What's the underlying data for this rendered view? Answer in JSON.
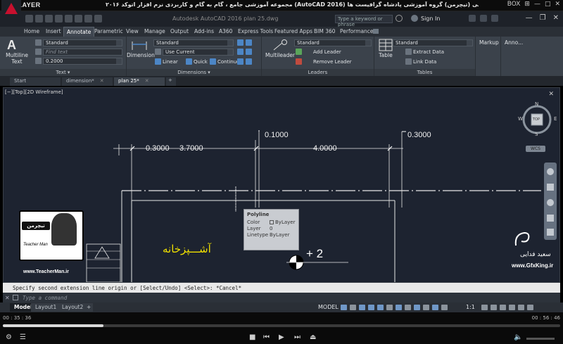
{
  "player": {
    "logo": "KMPLAYER",
    "title": "مجموعه آموزشی جامع ، گام به گام و کاربردی نرم افزار اتوکد ۲۰۱۶ (AutoCAD 2016) مدرس : سعید فدایی (تیچرمن) گروه آموزشی پادشاه گرافیست ها",
    "controls": [
      "BOX",
      "⊞",
      "—",
      "□",
      "✕"
    ],
    "time_elapsed": "00 : 35 : 36",
    "time_total": "00 : 56 : 46",
    "progress": 0.18
  },
  "acad": {
    "app_title": "Autodesk AutoCAD 2016   plan 25.dwg",
    "search_placeholder": "Type a keyword or phrase",
    "signin": "Sign In",
    "tabs": [
      "Home",
      "Insert",
      "Annotate",
      "Parametric",
      "View",
      "Manage",
      "Output",
      "Add-ins",
      "A360",
      "Express Tools",
      "Featured Apps",
      "BIM 360",
      "Performance"
    ],
    "active_tab": "Annotate"
  },
  "ribbon": {
    "text_panel": {
      "big_label_1": "Multiline",
      "big_label_2": "Text",
      "style": "Standard",
      "find_placeholder": "Find text",
      "height": "0.2000",
      "label": "Text ▾"
    },
    "dim_panel": {
      "big_label": "Dimension",
      "style": "Standard",
      "layer": "Use Current",
      "linear": "Linear",
      "quick": "Quick",
      "continue": "Continue",
      "label": "Dimensions ▾"
    },
    "leader_panel": {
      "big_label": "Multileader",
      "style": "Standard",
      "add": "Add Leader",
      "remove": "Remove Leader",
      "label": "Leaders"
    },
    "table_panel": {
      "big_label": "Table",
      "style": "Standard",
      "extract": "Extract Data",
      "link": "Link Data",
      "label": "Tables"
    },
    "markup_label": "Markup",
    "anno_label": "Anno..."
  },
  "file_tabs": [
    "Start",
    "dimension*",
    "plan 25*"
  ],
  "viewport": {
    "label": "[−][Top][2D Wireframe]",
    "dims": {
      "d1": "0.3000",
      "d2": "3.7000",
      "d3": "0.1000",
      "d4": "4.0000",
      "d5": "0.3000"
    },
    "room_label": "آشـــپزخانه",
    "level_text": "+ 2",
    "viewcube": {
      "n": "N",
      "s": "S",
      "e": "E",
      "w": "W",
      "top": "TOP"
    },
    "wcs": "WCS"
  },
  "tooltip": {
    "title": "Polyline",
    "rows": [
      {
        "k": "Color",
        "v": "ByLayer"
      },
      {
        "k": "Layer",
        "v": "0"
      },
      {
        "k": "Linetype",
        "v": "ByLayer"
      }
    ]
  },
  "watermarks": {
    "teacher_badge": "تیچرمن",
    "teacher_name": "Teacher Man",
    "teacher_url": "www.TeacherMan.ir",
    "gfx_name": "سعید فدایی",
    "gfx_url": "www.GfxKing.ir"
  },
  "command": {
    "history": "Specify second extension line origin or [Select/Undo] <Select>: *Cancel*",
    "placeholder": "Type a command"
  },
  "status": {
    "layouts": [
      "Model",
      "Layout1",
      "Layout2"
    ],
    "model": "MODEL",
    "scale": "1:1"
  },
  "colors": {
    "accent_red": "#c8102e",
    "canvas": "#1d2330",
    "room_text": "#f0e000"
  }
}
